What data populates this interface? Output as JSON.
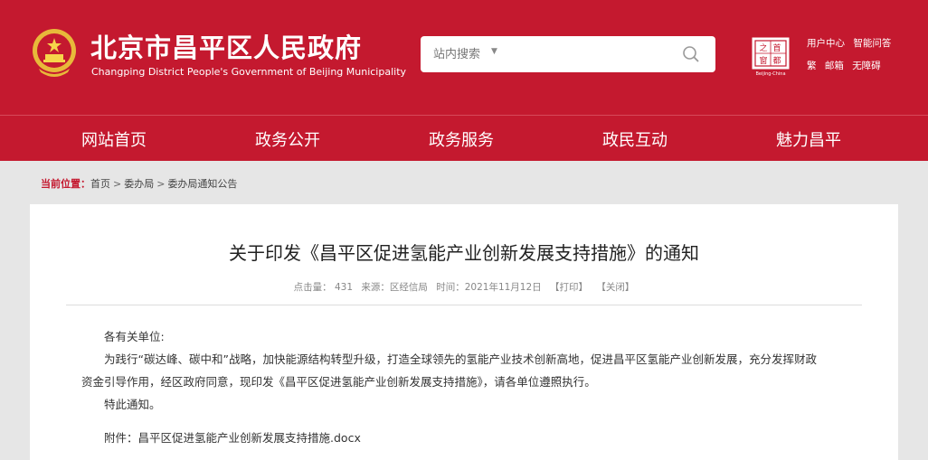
{
  "header": {
    "title": "北京市昌平区人民政府",
    "subtitle": "Changping District People's Government of Beijing Municipality",
    "search_placeholder": "站内搜索",
    "capital_logo": {
      "chars": [
        "首",
        "都",
        "之",
        "窗"
      ],
      "caption": "Beijing-China"
    },
    "top_links_row1": [
      "用户中心",
      "智能问答"
    ],
    "top_links_row2": [
      "繁",
      "邮箱",
      "无障碍"
    ]
  },
  "nav": [
    "网站首页",
    "政务公开",
    "政务服务",
    "政民互动",
    "魅力昌平"
  ],
  "breadcrumb": {
    "label": "当前位置：",
    "items": [
      "首页",
      "委办局",
      "委办局通知公告"
    ],
    "separator": ">"
  },
  "article": {
    "title": "关于印发《昌平区促进氢能产业创新发展支持措施》的通知",
    "meta": {
      "hits": "点击量： 431",
      "source": "来源：区经信局",
      "time": "时间：2021年11月12日",
      "print": "【打印】",
      "close": "【关闭】"
    },
    "salutation": "各有关单位:",
    "para1_line1": "为践行“碳达峰、碳中和”战略，加快能源结构转型升级，打造全球领先的氢能产业技术创新高地，促进昌平区氢能产业创新发展，充分发挥财政",
    "para1_line2": "资金引导作用，经区政府同意，现印发《昌平区促进氢能产业创新发展支持措施》，请各单位遵照执行。",
    "closing": "特此通知。",
    "attachment_label": "附件：",
    "attachment_file": "昌平区促进氢能产业创新发展支持措施.docx"
  },
  "colors": {
    "primary": "#c4192f",
    "background": "#e6e6e6",
    "gold": "#f2c23a"
  },
  "icons": {
    "emblem": "national-emblem-icon",
    "search": "search-icon",
    "dropdown": "chevron-down-icon"
  }
}
